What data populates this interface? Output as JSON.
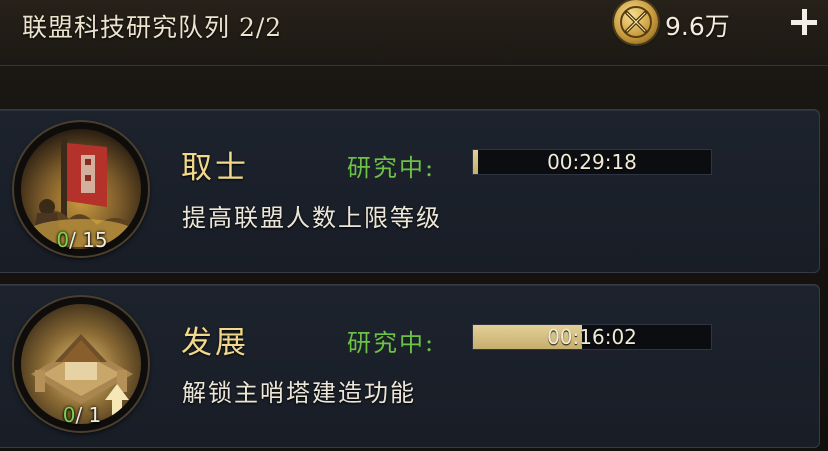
{
  "header": {
    "title": "联盟科技研究队列 2/2",
    "currency_amount": "9.6万",
    "currency_icon": "crossed-swords-coin-icon",
    "add_icon": "plus-icon"
  },
  "techs": [
    {
      "name": "取士",
      "status": "研究中:",
      "timer": "00:29:18",
      "progress": 0.02,
      "description": "提高联盟人数上限等级",
      "level_current": "0",
      "level_max": "/ 15",
      "icon": "banner-soldiers-icon"
    },
    {
      "name": "发展",
      "status": "研究中:",
      "timer": "00:16:02",
      "progress": 0.46,
      "description": "解锁主哨塔建造功能",
      "level_current": "0",
      "level_max": "/ 1",
      "icon": "fortress-upgrade-icon"
    }
  ],
  "colors": {
    "name": "#f2d98a",
    "status": "#6cc245",
    "progress_fill": "#d8c283",
    "level_current": "#7bd44e"
  }
}
